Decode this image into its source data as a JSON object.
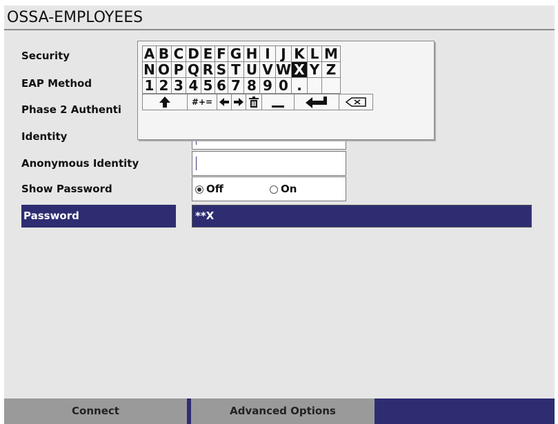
{
  "window": {
    "title": "OSSA-EMPLOYEES"
  },
  "form": {
    "security_label": "Security",
    "eap_method_label": "EAP Method",
    "phase2_label": "Phase 2 Authenti",
    "identity_label": "Identity",
    "identity_value": "",
    "anon_identity_label": "Anonymous Identity",
    "anon_identity_value": "",
    "show_password_label": "Show Password",
    "show_password_off": "Off",
    "show_password_on": "On",
    "show_password_selected": "Off",
    "password_label": "Password",
    "password_value": "**X"
  },
  "keyboard": {
    "row1": [
      "A",
      "B",
      "C",
      "D",
      "E",
      "F",
      "G",
      "H",
      "I",
      "J",
      "K",
      "L",
      "M"
    ],
    "row2": [
      "N",
      "O",
      "P",
      "Q",
      "R",
      "S",
      "T",
      "U",
      "V",
      "W",
      "X",
      "Y",
      "Z"
    ],
    "row3": [
      "1",
      "2",
      "3",
      "4",
      "5",
      "6",
      "7",
      "8",
      "9",
      "0",
      ".",
      "",
      ""
    ],
    "highlighted_key": "X",
    "shift_icon": "shift-arrow-icon",
    "symbols_label": "#+=",
    "left_icon": "arrow-left-icon",
    "right_icon": "arrow-right-icon",
    "trash_icon": "trash-icon",
    "space_icon": "space-bar-icon",
    "enter_icon": "enter-icon",
    "backspace_icon": "backspace-icon"
  },
  "bottom_bar": {
    "connect_label": "Connect",
    "advanced_label": "Advanced Options"
  },
  "colors": {
    "selection": "#2e2d72",
    "background": "#e6e6e6",
    "bottom_button": "#9a9a9a"
  }
}
